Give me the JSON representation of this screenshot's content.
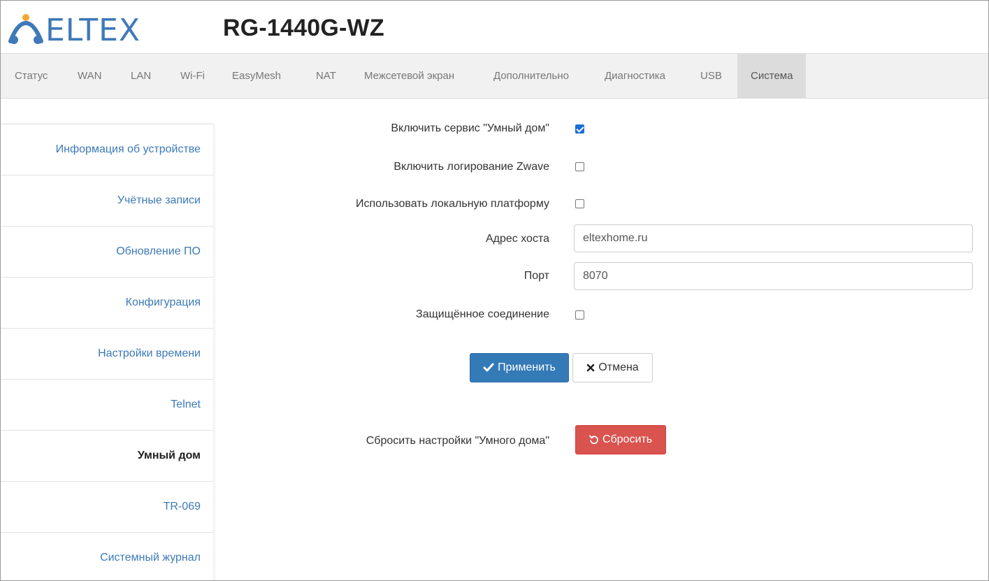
{
  "header": {
    "logo_text": "ELTEX",
    "model": "RG-1440G-WZ",
    "logo_color": "#3f79b9",
    "logo_accent_color": "#f0a830"
  },
  "nav": {
    "tabs": [
      {
        "label": "Статус"
      },
      {
        "label": "WAN"
      },
      {
        "label": "LAN"
      },
      {
        "label": "Wi-Fi"
      },
      {
        "label": "EasyMesh"
      },
      {
        "label": "NAT"
      },
      {
        "label": "Межсетевой экран"
      },
      {
        "label": "Дополнительно"
      },
      {
        "label": "Диагностика"
      },
      {
        "label": "USB"
      },
      {
        "label": "Система"
      }
    ],
    "active": "Система"
  },
  "sidebar": {
    "items": [
      {
        "label": "Информация об устройстве"
      },
      {
        "label": "Учётные записи"
      },
      {
        "label": "Обновление ПО"
      },
      {
        "label": "Конфигурация"
      },
      {
        "label": "Настройки времени"
      },
      {
        "label": "Telnet"
      },
      {
        "label": "Умный дом"
      },
      {
        "label": "TR-069"
      },
      {
        "label": "Системный журнал"
      }
    ],
    "active": "Умный дом"
  },
  "form": {
    "enable_service": {
      "label": "Включить сервис \"Умный дом\"",
      "checked": true
    },
    "enable_zwave_log": {
      "label": "Включить логирование Zwave",
      "checked": false
    },
    "use_local_platform": {
      "label": "Использовать локальную платформу",
      "checked": false
    },
    "host": {
      "label": "Адрес хоста",
      "value": "eltexhome.ru"
    },
    "port": {
      "label": "Порт",
      "value": "8070"
    },
    "secure": {
      "label": "Защищённое соединение",
      "checked": false
    },
    "apply_label": "Применить",
    "cancel_label": "Отмена",
    "reset_label_text": "Сбросить настройки \"Умного дома\"",
    "reset_button": "Сбросить"
  },
  "colors": {
    "primary": "#337ab7",
    "danger": "#d9534f",
    "link": "#3b7ab7"
  }
}
